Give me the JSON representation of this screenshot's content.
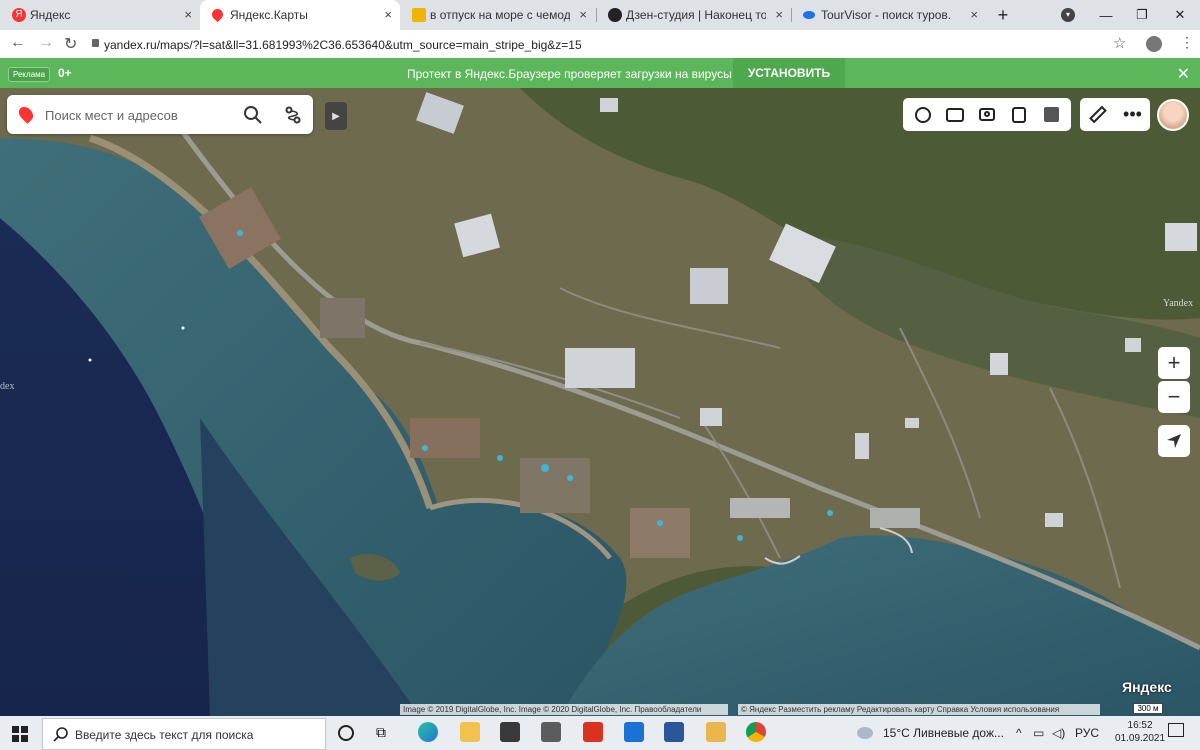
{
  "tabs": [
    {
      "title": "Яндекс",
      "close": "×"
    },
    {
      "title": "Яндекс.Карты",
      "close": "×"
    },
    {
      "title": "в отпуск на море с чемоданом",
      "close": "×"
    },
    {
      "title": "Дзен-студия | Наконец то мы з",
      "close": "×"
    },
    {
      "title": "TourVisor - поиск туров.",
      "close": "×"
    }
  ],
  "new_tab": "+",
  "address": {
    "url": "yandex.ru/maps/?l=sat&ll=31.681993%2C36.653640&utm_source=main_stripe_big&z=15"
  },
  "promo": {
    "ad_label": "Реклама",
    "age": "0+",
    "text": "Протект в Яндекс.Браузере проверяет загрузки на вирусы",
    "button": "УСТАНОВИТЬ"
  },
  "search": {
    "placeholder": "Поиск мест и адресов"
  },
  "map": {
    "zoom_in": "+",
    "zoom_out": "−",
    "side_text": "dex",
    "watermark": "Yandex",
    "logo": "Яндекс",
    "scale": "300 м",
    "attribution_left": "Image © 2019 DigitalGlobe, Inc. Image © 2020 DigitalGlobe, Inc.   Правообладатели",
    "attribution_right": "© Яндекс   Разместить рекламу   Редактировать карту   Справка   Условия использования"
  },
  "taskbar": {
    "search_text": "Введите здесь текст для поиска",
    "weather": "15°C  Ливневые дож...",
    "lang": "РУС",
    "time": "16:52",
    "date": "01.09.2021"
  }
}
